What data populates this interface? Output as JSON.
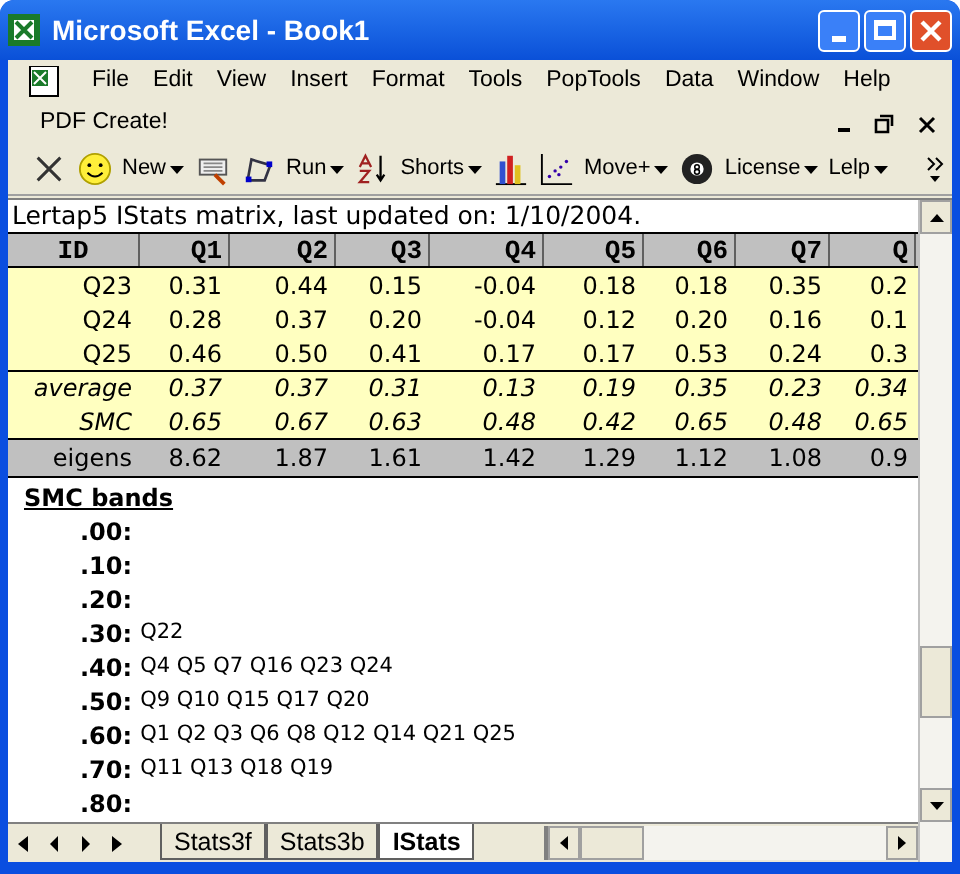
{
  "window": {
    "title": "Microsoft Excel - Book1"
  },
  "menu": {
    "items": [
      "File",
      "Edit",
      "View",
      "Insert",
      "Format",
      "Tools",
      "PopTools",
      "Data",
      "Window",
      "Help"
    ]
  },
  "menu_row2": {
    "items": [
      "PDF Create!"
    ]
  },
  "toolbar": {
    "buttons": [
      "New",
      "Run",
      "Shorts",
      "Move+",
      "License",
      "Lelp"
    ]
  },
  "sheet": {
    "info_line": "Lertap5 IStats matrix, last updated on: 1/10/2004.",
    "columns": [
      "ID",
      "Q1",
      "Q2",
      "Q3",
      "Q4",
      "Q5",
      "Q6",
      "Q7",
      "Q"
    ],
    "rows": [
      {
        "kind": "item",
        "cells": [
          "Q23",
          "0.31",
          "0.44",
          "0.15",
          "-0.04",
          "0.18",
          "0.18",
          "0.35",
          "0.2"
        ]
      },
      {
        "kind": "item",
        "cells": [
          "Q24",
          "0.28",
          "0.37",
          "0.20",
          "-0.04",
          "0.12",
          "0.20",
          "0.16",
          "0.1"
        ]
      },
      {
        "kind": "item",
        "cells": [
          "Q25",
          "0.46",
          "0.50",
          "0.41",
          "0.17",
          "0.17",
          "0.53",
          "0.24",
          "0.3"
        ]
      },
      {
        "kind": "summary",
        "cells": [
          "average",
          "0.37",
          "0.37",
          "0.31",
          "0.13",
          "0.19",
          "0.35",
          "0.23",
          "0.34"
        ]
      },
      {
        "kind": "summary",
        "cells": [
          "SMC",
          "0.65",
          "0.67",
          "0.63",
          "0.48",
          "0.42",
          "0.65",
          "0.48",
          "0.65"
        ]
      },
      {
        "kind": "eigen",
        "cells": [
          "eigens",
          "8.62",
          "1.87",
          "1.61",
          "1.42",
          "1.29",
          "1.12",
          "1.08",
          "0.9"
        ]
      }
    ],
    "smc_bands": {
      "title": "SMC bands",
      "bands": [
        {
          "label": ".00:"
        },
        {
          "label": ".10:"
        },
        {
          "label": ".20:"
        },
        {
          "label": ".30:",
          "items": "Q22"
        },
        {
          "label": ".40:",
          "items": "Q4 Q5 Q7 Q16 Q23 Q24"
        },
        {
          "label": ".50:",
          "items": "Q9 Q10 Q15 Q17 Q20"
        },
        {
          "label": ".60:",
          "items": "Q1 Q2 Q3 Q6 Q8 Q12 Q14 Q21 Q25"
        },
        {
          "label": ".70:",
          "items": "Q11 Q13 Q18 Q19"
        },
        {
          "label": ".80:"
        }
      ]
    }
  },
  "sheet_tabs": [
    {
      "label": "Stats3f",
      "selected": false
    },
    {
      "label": "Stats3b",
      "selected": false
    },
    {
      "label": "IStats",
      "selected": true
    }
  ]
}
